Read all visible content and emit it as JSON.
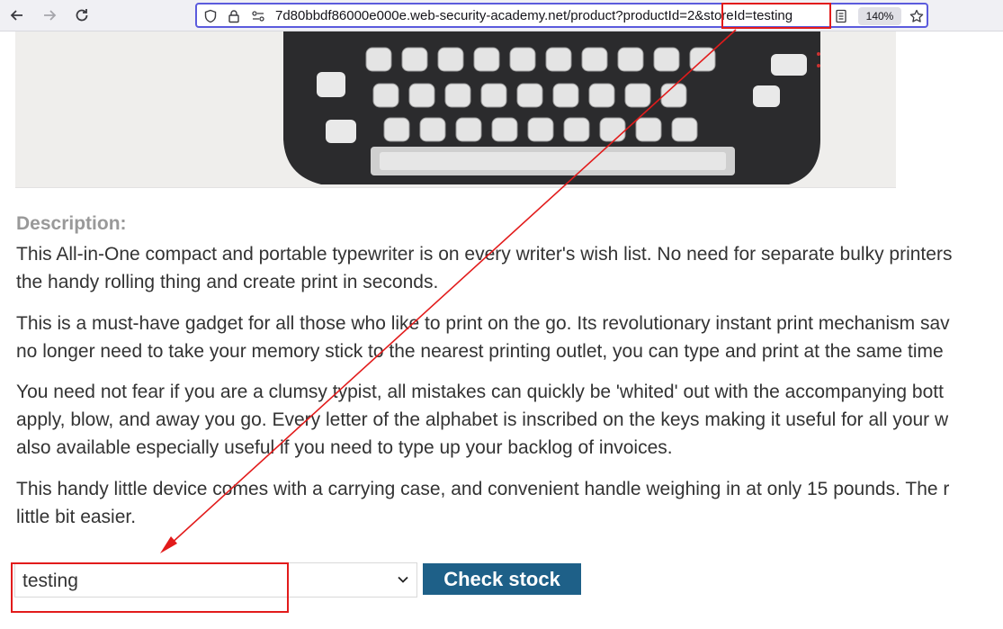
{
  "browser": {
    "url": "7d80bbdf86000e000e.web-security-academy.net/product?productId=2&storeId=testing",
    "zoom": "140%"
  },
  "description": {
    "heading": "Description:",
    "paragraphs": [
      [
        "This All-in-One compact and portable typewriter is on every writer's wish list. No need for separate bulky printers",
        "the handy rolling thing and create print in seconds."
      ],
      [
        "This is a must-have gadget for all those who like to print on the go. Its revolutionary instant print mechanism sav",
        "no longer need to take your memory stick to the nearest printing outlet, you can type and print at the same time"
      ],
      [
        "You need not fear if you are a clumsy typist, all mistakes can quickly be 'whited' out with the accompanying bott",
        "apply, blow, and away you go. Every letter of the alphabet is inscribed on the keys making it useful for all your w",
        "also available especially useful if you need to type up your backlog of invoices."
      ],
      [
        "This handy little device comes with a carrying case, and convenient handle weighing in at only 15 pounds. The r",
        "little bit easier."
      ]
    ]
  },
  "stock_form": {
    "selected_store": "testing",
    "check_label": "Check stock"
  },
  "icons": [
    "back-arrow-icon",
    "forward-arrow-icon",
    "reload-icon",
    "shield-icon",
    "lock-icon",
    "site-info-icon",
    "reader-view-icon",
    "bookmark-star-icon",
    "chevron-down-icon"
  ],
  "annotation_color": "#e21b1b"
}
